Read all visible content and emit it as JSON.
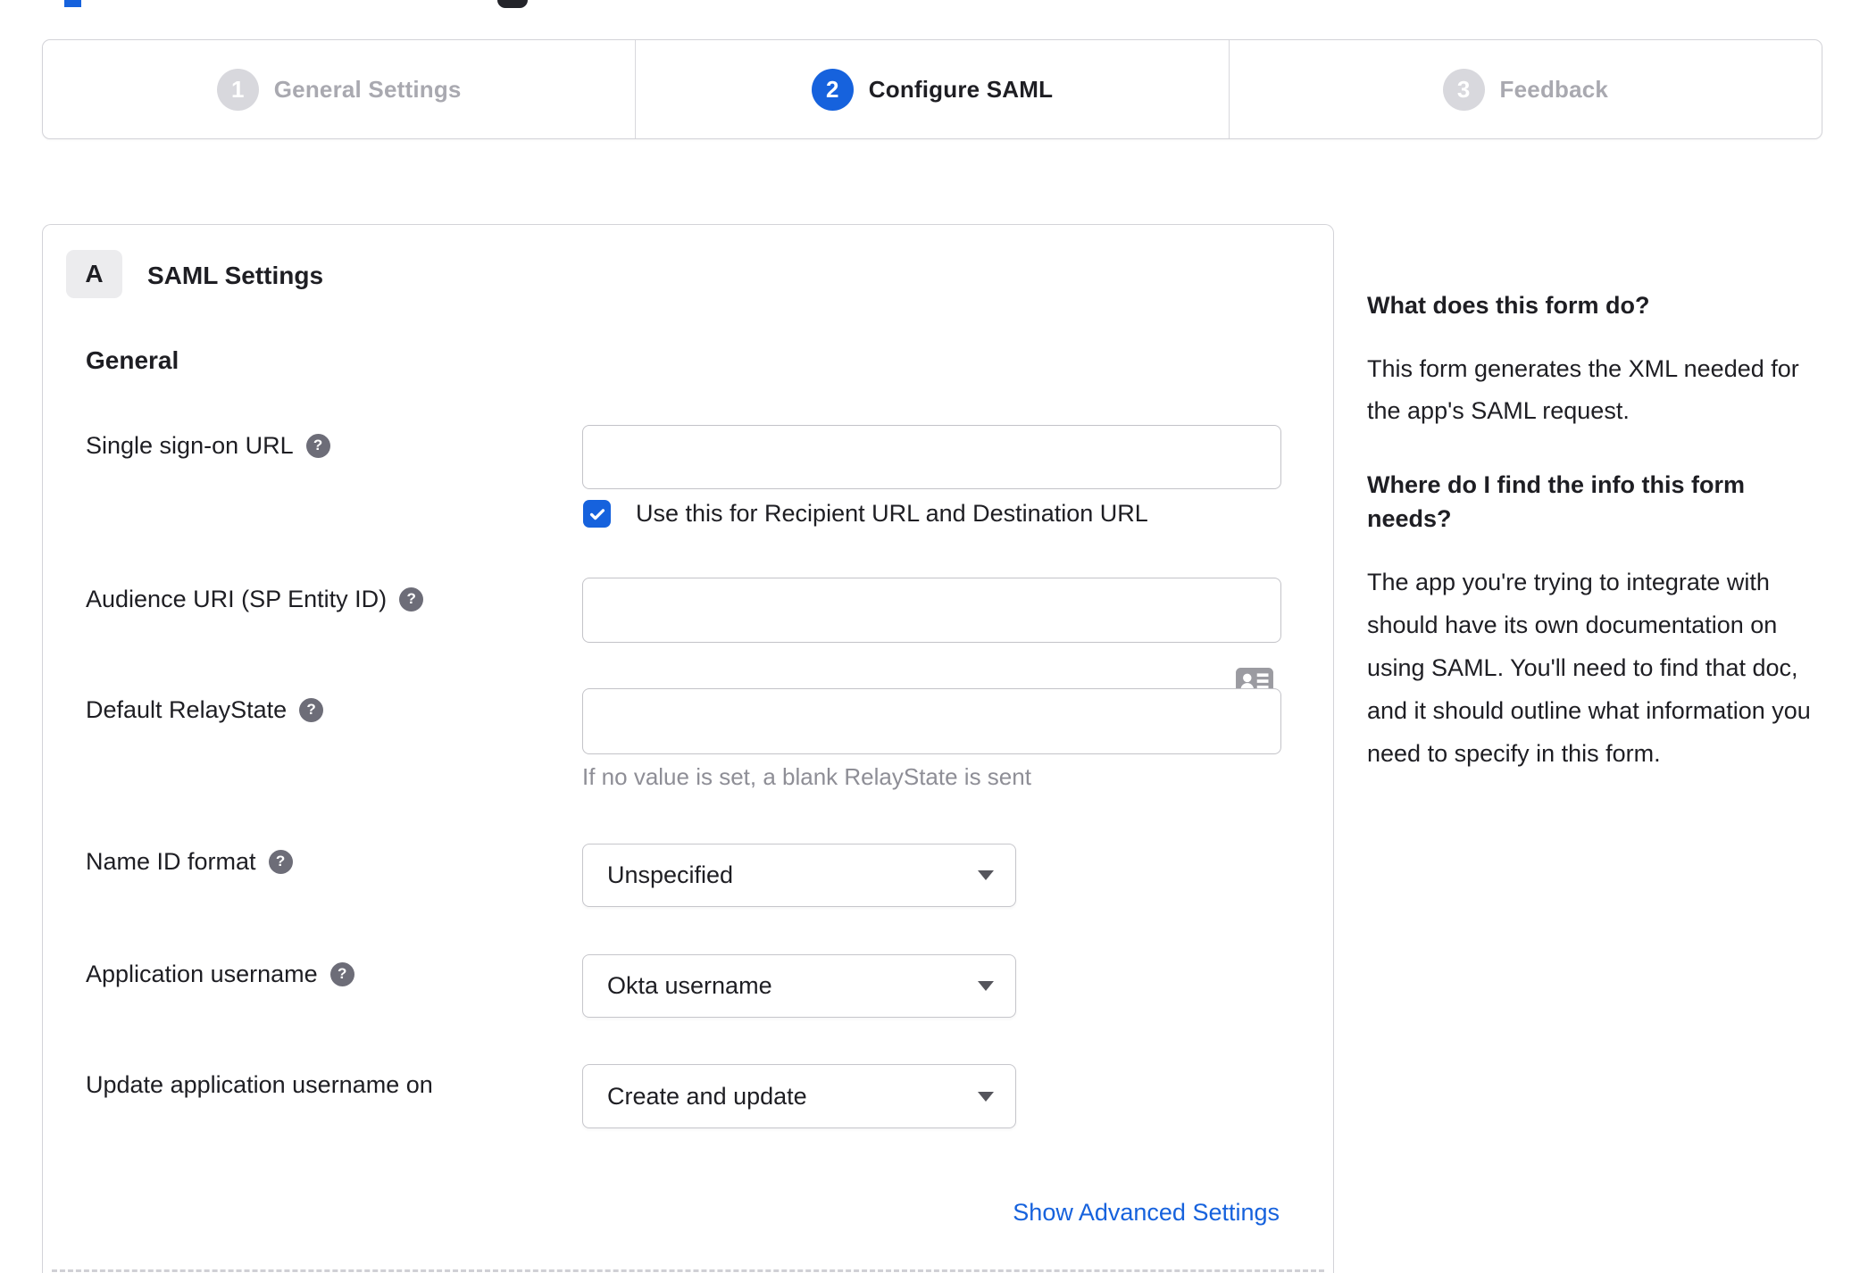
{
  "colors": {
    "accent": "#1662dd",
    "text": "#1e1e23",
    "inactive_step": "#a9a9b0",
    "border": "#d3d3d8",
    "hint_text": "#8e8e96",
    "link": "#1662dd"
  },
  "stepper": {
    "active_step": "2",
    "steps": [
      {
        "number": "1",
        "label": "General Settings"
      },
      {
        "number": "2",
        "label": "Configure SAML"
      },
      {
        "number": "3",
        "label": "Feedback"
      }
    ]
  },
  "panel": {
    "badge": "A",
    "title": "SAML Settings",
    "section": "General",
    "rows": {
      "sso": {
        "label": "Single sign-on URL",
        "value": "",
        "checkbox_checked": true,
        "checkbox_label": "Use this for Recipient URL and Destination URL"
      },
      "audience": {
        "label": "Audience URI (SP Entity ID)",
        "value": ""
      },
      "relay": {
        "label": "Default RelayState",
        "value": "",
        "hint": "If no value is set, a blank RelayState is sent"
      },
      "nameid": {
        "label": "Name ID format",
        "value": "Unspecified"
      },
      "appuser": {
        "label": "Application username",
        "value": "Okta username"
      },
      "updateuser": {
        "label": "Update application username on",
        "value": "Create and update"
      }
    },
    "advanced_link": "Show Advanced Settings"
  },
  "sidebar": {
    "heading1": "What does this form do?",
    "body1": "This form generates the XML needed for the app's SAML request.",
    "heading2": "Where do I find the info this form needs?",
    "body2": "The app you're trying to integrate with should have its own documentation on using SAML. You'll need to find that doc, and it should outline what information you need to specify in this form."
  }
}
